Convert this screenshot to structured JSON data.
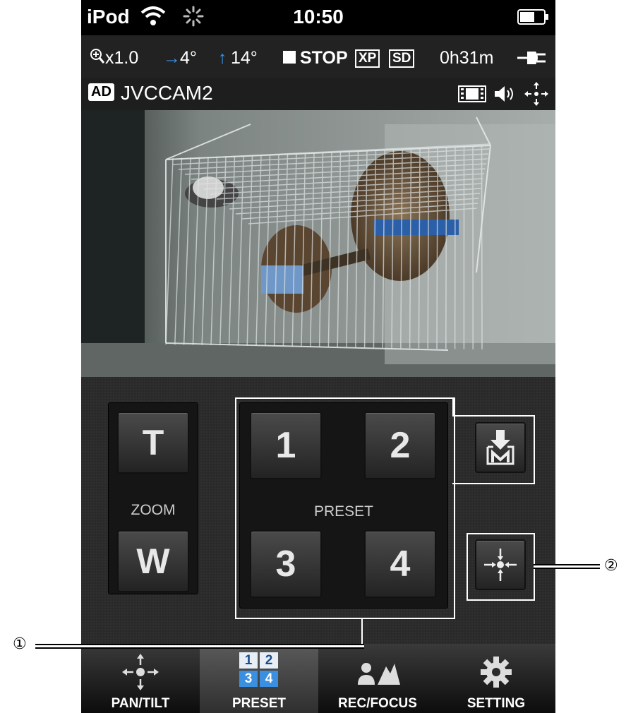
{
  "status_bar": {
    "carrier": "iPod",
    "time": "10:50"
  },
  "info_bar": {
    "zoom": "x1.0",
    "pan": "4°",
    "tilt": "14°",
    "rec_state": "STOP",
    "mode_xp": "XP",
    "mode_sd": "SD",
    "remaining": "0h31m"
  },
  "camera": {
    "badge": "AD",
    "name": "JVCCAM2"
  },
  "zoom": {
    "tele_label": "T",
    "wide_label": "W",
    "label": "ZOOM"
  },
  "preset": {
    "buttons": [
      "1",
      "2",
      "3",
      "4"
    ],
    "label": "PRESET"
  },
  "tabs": [
    {
      "label": "PAN/TILT",
      "icon": "pan-tilt-icon"
    },
    {
      "label": "PRESET",
      "icon": "preset-grid-icon",
      "grid": [
        "1",
        "2",
        "3",
        "4"
      ]
    },
    {
      "label": "REC/FOCUS",
      "icon": "rec-focus-icon"
    },
    {
      "label": "SETTING",
      "icon": "gear-icon"
    }
  ],
  "active_tab": "PRESET",
  "callouts": [
    "①",
    "②"
  ],
  "colors": {
    "accent_blue": "#3a8fe0",
    "tab_active": "#4a4a4a"
  }
}
